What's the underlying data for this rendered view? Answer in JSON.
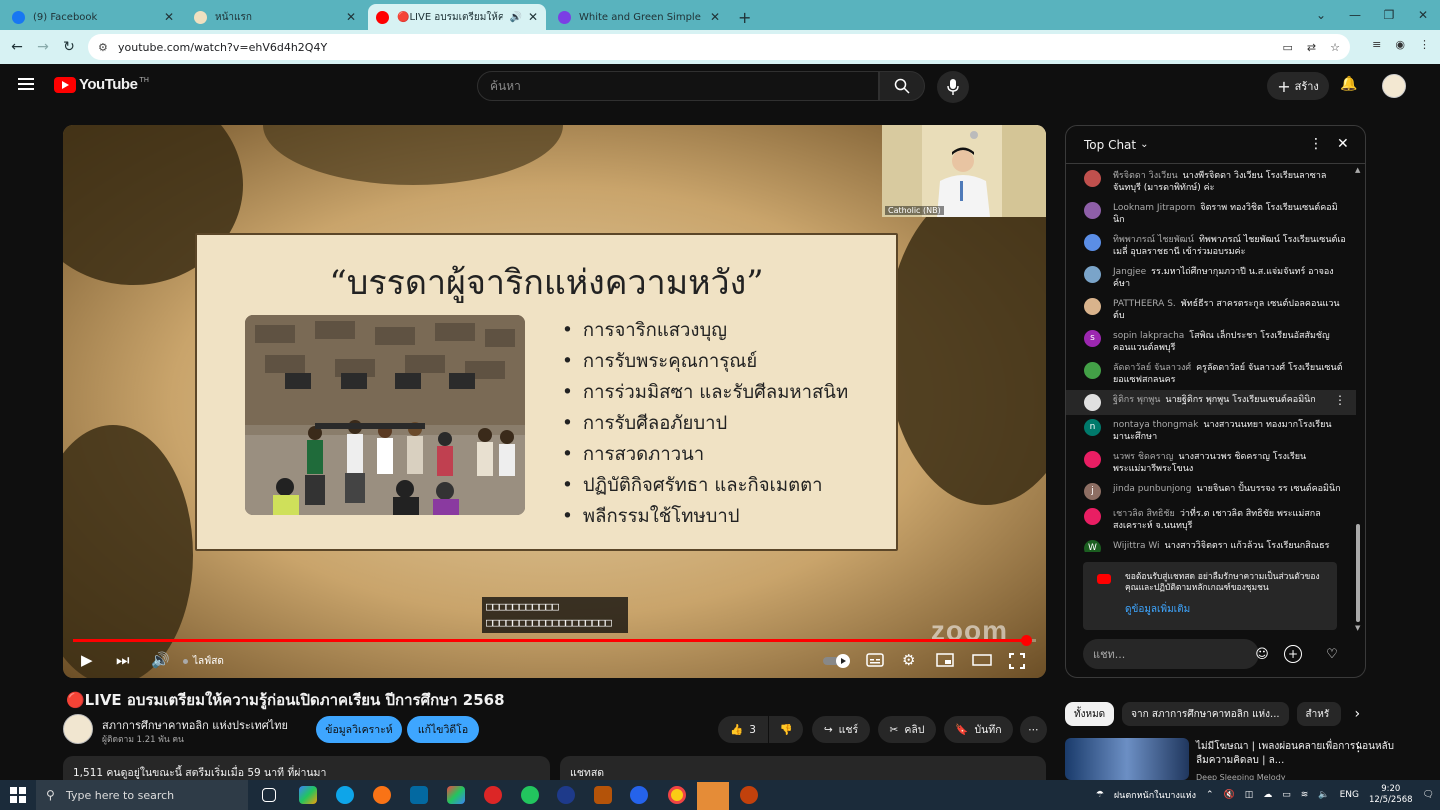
{
  "browser": {
    "tabs": [
      {
        "title": "(9) Facebook",
        "color": "#1877f2"
      },
      {
        "title": "หน้าแรก",
        "color": "#f0e0c0"
      },
      {
        "title": "🔴LIVE อบรมเตรียมให้ความรู้ก่อนเ",
        "color": "#ff0000"
      },
      {
        "title": "White and Green Simple Profess",
        "color": "#7b3fe4"
      }
    ],
    "url": "youtube.com/watch?v=ehV6d4h2Q4Y"
  },
  "youtube": {
    "logo_text": "YouTube",
    "country": "TH",
    "search_placeholder": "ค้นหา",
    "create_label": "สร้าง"
  },
  "player": {
    "slide_title": "“บรรดาผู้จาริกแห่งความหวัง”",
    "bullets": [
      "การจาริกแสวงบุญ",
      "การรับพระคุณการุณย์",
      "การร่วมมิสซา และรับศีลมหาสนิท",
      "การรับศีลอภัยบาป",
      "การสวดภาวนา",
      "ปฏิบัติกิจศรัทธา และกิจเมตตา",
      "พลีกรรมใช้โทษบาป"
    ],
    "camera_label": "Catholic (NB)",
    "caption_lines": [
      "□□□□□□□□□□□",
      "□□□□□□□□□□□□□□□□□□□"
    ],
    "watermark": "zoom",
    "live_label": "ไลฟ์สด",
    "progress": 0.99
  },
  "chat": {
    "header": "Top Chat",
    "messages": [
      {
        "name": "พีรจิตดา วิงเวียน",
        "text": "นางพีรจิตดา วิงเวียน โรงเรียนลาซาลจันทบุรี (มารดาพิทักษ์) ค่ะ",
        "avatar_color": "#c0504d",
        "initial": ""
      },
      {
        "name": "Looknam Jitraporn",
        "text": "จิตราพ ทองวิชิต โรงเรียนเซนต์คอมินิก",
        "avatar_color": "#8e5fa8",
        "initial": ""
      },
      {
        "name": "ทิพพาภรณ์ ไชยพัฒน์",
        "text": "ทิพพาภรณ์ ไชยพัฒน์ โรงเรียนเซนต์เอเมลี่ อุบลราชธานี เข้าร่วมอบรมค่ะ",
        "avatar_color": "#5b8ee6",
        "initial": ""
      },
      {
        "name": "Jangjee",
        "text": "รร.มหาไถ่ศึกษากุมภวาปี น.ส.แจ่มจันทร์ อาจองค์ษา",
        "avatar_color": "#7aa4c9",
        "initial": ""
      },
      {
        "name": "PATTHEERA S.",
        "text": "พัทธ์ธีรา สาครตระกูล เซนต์ปอลคอนแวน ต์บ",
        "avatar_color": "#d9b38c",
        "initial": ""
      },
      {
        "name": "sopin lakpracha",
        "text": "โสพิณ เล็กประชา โรงเรียนอัสสัมชัญคอนแวนต์ลพบุรี",
        "avatar_color": "#9c27b0",
        "initial": "s"
      },
      {
        "name": "ลัดดาวัลย์ จันลาวงศ์",
        "text": "ครูลัดดาวัลย์ จันลาวงศ์ โรงเรียนเซนต์ยอแซฟสกลนคร",
        "avatar_color": "#43a047",
        "initial": ""
      },
      {
        "name": "ฐิติกร พุกพูน",
        "text": "นายฐิติกร พุกพูน โรงเรียนเซนต์คอมินิก",
        "avatar_color": "#e0e0e0",
        "initial": ""
      },
      {
        "name": "nontaya thongmak",
        "text": "นางสาวนนทยา ทองมากโรงเรียนมานะศึกษา",
        "avatar_color": "#00796b",
        "initial": "n"
      },
      {
        "name": "นวพร ชิดคราญ",
        "text": "นางสาวนวพร ชิดคราญ โรงเรียนพระแม่มารีพระโขนง",
        "avatar_color": "#e91e63",
        "initial": ""
      },
      {
        "name": "jinda punbunjong",
        "text": "นายจินดา ปั้นบรรจง รร เซนต์คอมินิก",
        "avatar_color": "#8d6e63",
        "initial": "j"
      },
      {
        "name": "เชาวลิต สิทธิชัย",
        "text": "ว่าที่ร.ต เชาวลิต สิทธิชัย พระแม่สกลสงเคราะห์ จ.นนทบุรี",
        "avatar_color": "#e91e63",
        "initial": ""
      },
      {
        "name": "Wijittra Wi",
        "text": "นางสาววิจิตตรา แก้วล้วน โรงเรียนกสิณธรวิทยาค่ะ",
        "avatar_color": "#1b5e20",
        "initial": "W"
      }
    ],
    "notice_text": "ขอต้อนรับสู่แชทสด อย่าลืมรักษาความเป็นส่วนตัวของคุณและปฏิบัติตามหลักเกณฑ์ของชุมชน",
    "notice_link": "ดูข้อมูลเพิ่มเติม",
    "input_placeholder": "แชท..."
  },
  "video": {
    "title": "🔴LIVE อบรมเตรียมให้ความรู้ก่อนเปิดภาคเรียน ปีการศึกษา 2568",
    "channel": "สภาการศึกษาคาทอลิก แห่งประเทศไทย",
    "subscribers": "ผู้ติดตาม 1.21 พัน คน",
    "analytics_btn": "ข้อมูลวิเคราะห์",
    "edit_btn": "แก้ไขวิดีโอ",
    "likes": "3",
    "share": "แชร์",
    "clip": "คลิป",
    "save": "บันทึก",
    "watching": "1,511 คนดูอยู่ในขณะนี้  สตรีมเริ่มเมื่อ 59 นาที ที่ผ่านมา",
    "live_chat_label": "แชทสด"
  },
  "sidebar": {
    "chips": [
      "ทั้งหมด",
      "จาก สภาการศึกษาคาทอลิก แห่ง...",
      "สำหรั"
    ],
    "rec_title": "ไม่มีโฆษณา | เพลงผ่อนคลายเพื่อการนอนหลับ ลืมความคิดลบ | ล...",
    "rec_channel": "Deep Sleeping Melody"
  },
  "taskbar": {
    "search_placeholder": "Type here to search",
    "weather": "ฝนตกหนักในบางแห่ง",
    "lang": "ENG",
    "time": "9:20",
    "date": "12/5/2568"
  }
}
